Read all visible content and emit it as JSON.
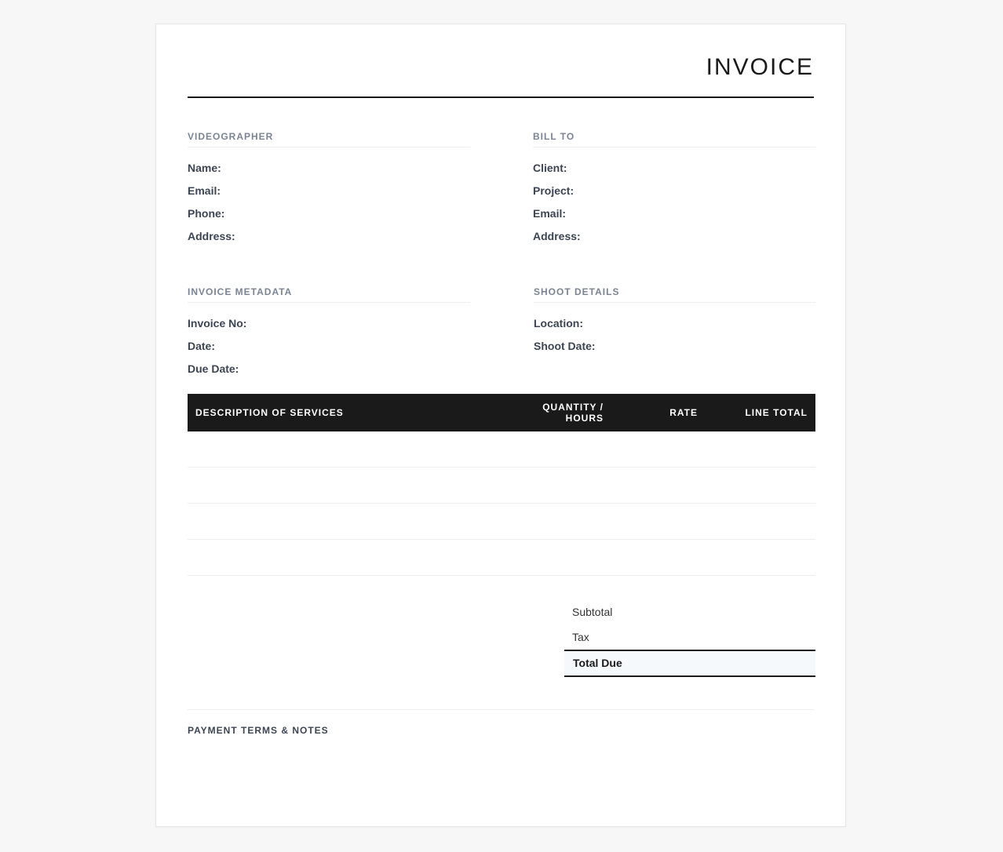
{
  "invoice": {
    "title": "INVOICE"
  },
  "videographer": {
    "heading": "VIDEOGRAPHER",
    "fields": [
      "Name:",
      "Email:",
      "Phone:",
      "Address:"
    ]
  },
  "bill_to": {
    "heading": "BILL TO",
    "fields": [
      "Client:",
      "Project:",
      "Email:",
      "Address:"
    ]
  },
  "metadata": {
    "heading": "INVOICE METADATA",
    "fields": [
      "Invoice No:",
      "Date:",
      "Due Date:"
    ]
  },
  "shoot": {
    "heading": "SHOOT DETAILS",
    "fields": [
      "Location:",
      "Shoot Date:"
    ]
  },
  "table": {
    "headers": {
      "description": "DESCRIPTION OF SERVICES",
      "quantity_line1": "QUANTITY /",
      "quantity_line2": "HOURS",
      "rate": "RATE",
      "line_total": "LINE TOTAL"
    }
  },
  "totals": {
    "subtotal_label": "Subtotal",
    "tax_label": "Tax",
    "total_due_label": "Total Due"
  },
  "notes": {
    "heading": "PAYMENT TERMS & NOTES"
  }
}
